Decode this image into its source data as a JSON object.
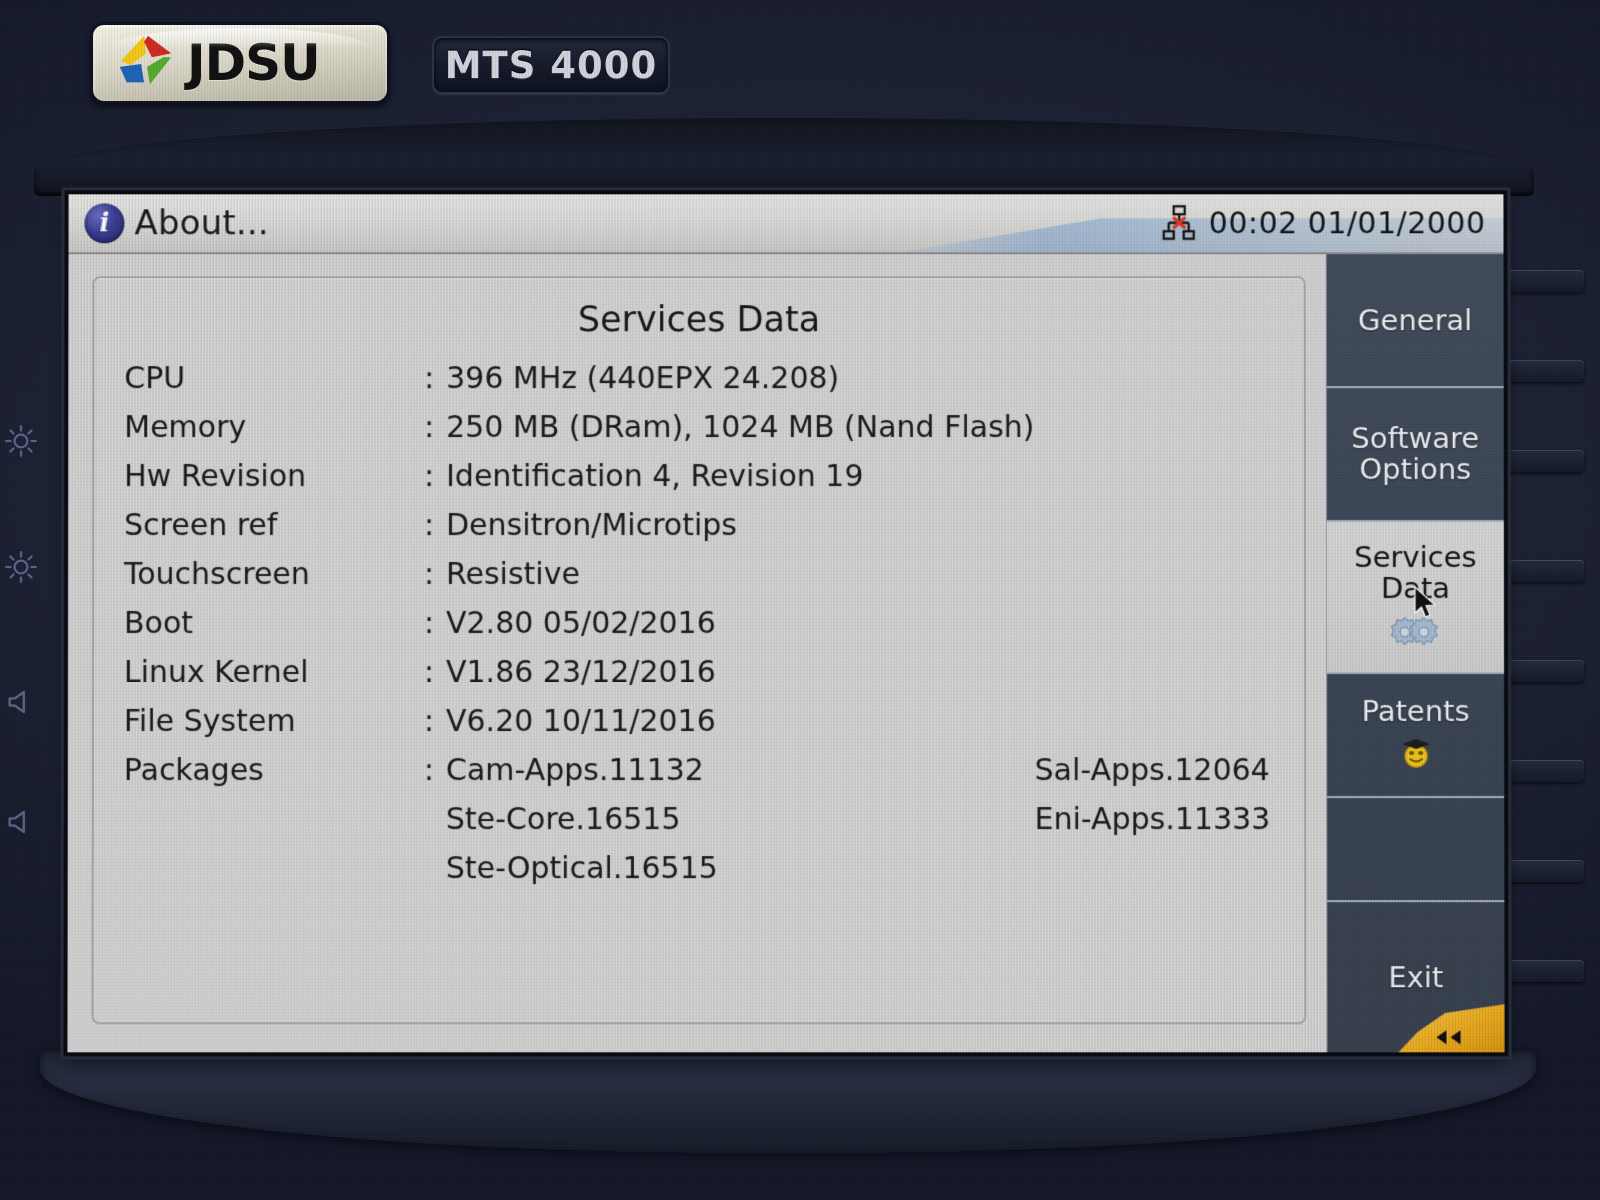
{
  "device": {
    "brand": "JDSU",
    "model": "MTS 4000"
  },
  "titlebar": {
    "title": "About...",
    "info_icon": "info-icon",
    "network_icon": "network-disconnected-icon",
    "time": "00:02",
    "date": "01/01/2000",
    "clock": "00:02  01/01/2000"
  },
  "panel": {
    "title": "Services Data",
    "rows": [
      {
        "label": "CPU",
        "sep": ":",
        "value": "396 MHz (440EPX 24.208)",
        "value2": ""
      },
      {
        "label": "Memory",
        "sep": ":",
        "value": "250 MB (DRam), 1024 MB (Nand Flash)",
        "value2": ""
      },
      {
        "label": "Hw Revision",
        "sep": ":",
        "value": "Identification 4, Revision 19",
        "value2": ""
      },
      {
        "label": "Screen ref",
        "sep": ":",
        "value": "Densitron/Microtips",
        "value2": ""
      },
      {
        "label": "Touchscreen",
        "sep": ":",
        "value": "Resistive",
        "value2": ""
      },
      {
        "label": "Boot",
        "sep": ":",
        "value": "V2.80   05/02/2016",
        "value2": ""
      },
      {
        "label": "Linux Kernel",
        "sep": ":",
        "value": "V1.86   23/12/2016",
        "value2": ""
      },
      {
        "label": "File System",
        "sep": ":",
        "value": "V6.20   10/11/2016",
        "value2": ""
      },
      {
        "label": "Packages",
        "sep": ":",
        "value": "Cam-Apps.11132",
        "value2": "Sal-Apps.12064"
      },
      {
        "label": "",
        "sep": "",
        "value": "Ste-Core.16515",
        "value2": "Eni-Apps.11333"
      },
      {
        "label": "",
        "sep": "",
        "value": "Ste-Optical.16515",
        "value2": ""
      }
    ]
  },
  "sidebar": {
    "items": [
      {
        "label": "General",
        "active": false,
        "icon": ""
      },
      {
        "label": "Software\nOptions",
        "label_l1": "Software",
        "label_l2": "Options",
        "active": false,
        "icon": ""
      },
      {
        "label": "Services Data",
        "label_l1": "Services",
        "label_l2": "Data",
        "active": true,
        "icon": "gears-icon"
      },
      {
        "label": "Patents",
        "active": false,
        "icon": "graduate-smiley-icon"
      },
      {
        "label": "",
        "active": false,
        "icon": ""
      },
      {
        "label": "Exit",
        "active": false,
        "icon": ""
      }
    ],
    "back_button": "back-icon"
  },
  "bezel": {
    "left_icons": [
      "brightness-up-icon",
      "brightness-down-icon",
      "volume-up-icon",
      "volume-down-icon"
    ]
  },
  "colors": {
    "lcd_background": "#d4d4d5",
    "sidebar_background": "#3c4656",
    "sidebar_active": "#d5d5d6",
    "accent_yellow": "#eeb427",
    "info_blue": "#3a3f94",
    "text": "#1a1a1a",
    "device_body": "#1c2133"
  }
}
